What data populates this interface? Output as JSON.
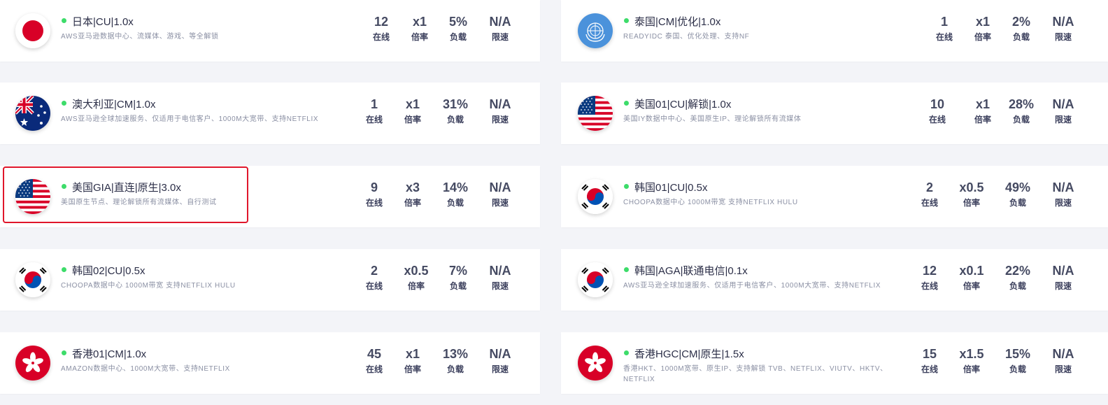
{
  "labels": {
    "online": "在线",
    "rate": "倍率",
    "load": "负载",
    "speed": "限速"
  },
  "colors": {
    "status_online": "#3ddc6a",
    "highlight_border": "#e0162b"
  },
  "nodes": [
    {
      "flag": "japan-flag-icon",
      "name": "日本|CU|1.0x",
      "desc": "AWS亚马逊数据中心、流媒体、游戏、等全解锁",
      "online": "12",
      "rate": "x1",
      "load": "5%",
      "speed": "N/A"
    },
    {
      "flag": "un-flag-icon",
      "name": "泰国|CM|优化|1.0x",
      "desc": "READYIDC 泰国、优化处理、支持NF",
      "online": "1",
      "rate": "x1",
      "load": "2%",
      "speed": "N/A"
    },
    {
      "flag": "australia-flag-icon",
      "name": "澳大利亚|CM|1.0x",
      "desc": "AWS亚马逊全球加速服务、仅适用于电信客户、1000M大宽带、支持NETFLIX",
      "online": "1",
      "rate": "x1",
      "load": "31%",
      "speed": "N/A"
    },
    {
      "flag": "usa-flag-icon",
      "name": "美国01|CU|解锁|1.0x",
      "desc": "美国IY数据中中心、美国原生IP、理论解锁所有流媒体",
      "online": "10",
      "rate": "x1",
      "load": "28%",
      "speed": "N/A"
    },
    {
      "flag": "usa-flag-icon",
      "name": "美国GIA|直连|原生|3.0x",
      "desc": "美国原生节点、理论解锁所有流媒体、自行测试",
      "online": "9",
      "rate": "x3",
      "load": "14%",
      "speed": "N/A",
      "selected": true
    },
    {
      "flag": "korea-flag-icon",
      "name": "韩国01|CU|0.5x",
      "desc": "CHOOPA数据中心 1000M带宽 支持NETFLIX HULU",
      "online": "2",
      "rate": "x0.5",
      "load": "49%",
      "speed": "N/A"
    },
    {
      "flag": "korea-flag-icon",
      "name": "韩国02|CU|0.5x",
      "desc": "CHOOPA数据中心 1000M带宽 支持NETFLIX HULU",
      "online": "2",
      "rate": "x0.5",
      "load": "7%",
      "speed": "N/A"
    },
    {
      "flag": "korea-flag-icon",
      "name": "韩国|AGA|联通电信|0.1x",
      "desc": "AWS亚马逊全球加速服务、仅适用于电信客户、1000M大宽带、支持NETFLIX",
      "online": "12",
      "rate": "x0.1",
      "load": "22%",
      "speed": "N/A"
    },
    {
      "flag": "hongkong-flag-icon",
      "name": "香港01|CM|1.0x",
      "desc": "AMAZON数据中心、1000M大宽带、支持NETFLIX",
      "online": "45",
      "rate": "x1",
      "load": "13%",
      "speed": "N/A"
    },
    {
      "flag": "hongkong-flag-icon",
      "name": "香港HGC|CM|原生|1.5x",
      "desc": "香港HKT、1000M宽带、原生IP、支持解锁 TVB、NETFLIX、VIUTV、HKTV、NETFLIX",
      "online": "15",
      "rate": "x1.5",
      "load": "15%",
      "speed": "N/A"
    }
  ]
}
